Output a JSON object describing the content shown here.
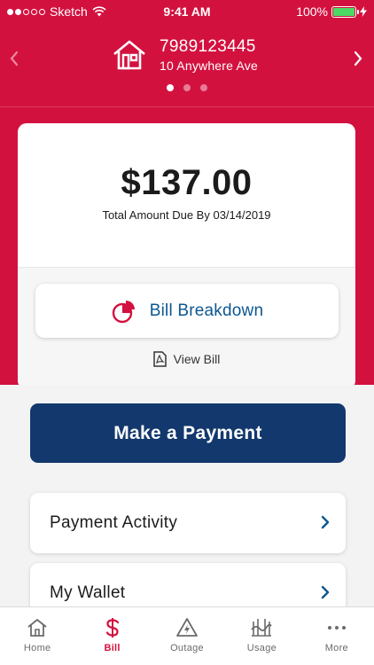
{
  "status_bar": {
    "carrier": "Sketch",
    "time": "9:41 AM",
    "battery": "100%"
  },
  "header": {
    "account_number": "7989123445",
    "address": "10 Anywhere Ave",
    "page_count": 3,
    "active_page": 1
  },
  "bill": {
    "amount": "$137.00",
    "due_text": "Total Amount Due By 03/14/2019",
    "breakdown_label": "Bill Breakdown",
    "view_bill_label": "View Bill"
  },
  "actions": {
    "make_payment": "Make a Payment"
  },
  "list": [
    {
      "label": "Payment Activity"
    },
    {
      "label": "My Wallet"
    }
  ],
  "tabs": [
    {
      "label": "Home",
      "icon": "home-icon"
    },
    {
      "label": "Bill",
      "icon": "dollar-icon",
      "active": true
    },
    {
      "label": "Outage",
      "icon": "outage-icon"
    },
    {
      "label": "Usage",
      "icon": "usage-icon"
    },
    {
      "label": "More",
      "icon": "more-icon"
    }
  ],
  "colors": {
    "brand_red": "#d3113f",
    "navy": "#12386d",
    "link_blue": "#0d5791",
    "battery_green": "#4cd964"
  }
}
